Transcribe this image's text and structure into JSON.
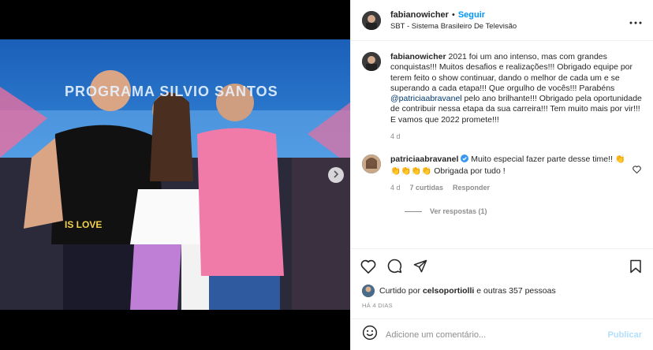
{
  "post": {
    "username": "fabianowicher",
    "follow_label": "Seguir",
    "location": "SBT - Sistema Brasileiro De Televisão",
    "caption_user": "fabianowicher",
    "caption_pre": " 2021 foi um ano intenso, mas com grandes conquistas!!! Muitos desafios e realizações!!! Obrigado equipe por terem feito o show continuar, dando o melhor de cada um e se superando a cada etapa!!! Que orgulho de vocês!!! Parabéns ",
    "caption_mention": "@patriciaabravanel",
    "caption_post": " pelo ano brilhante!!!  Obrigado pela oportunidade de contribuir nessa  etapa da sua carreira!!! Tem muito mais por vir!!!",
    "caption_line2": "E vamos que 2022 promete!!!",
    "caption_age": "4 d",
    "photo_banner": "PROGRAMA SILVIO SANTOS",
    "shirt_text": "IS LOVE"
  },
  "comment": {
    "user": "patriciaabravanel",
    "text": " Muito especial fazer parte desse time!! 👏 👏👏👏👏 Obrigada por tudo !",
    "age": "4 d",
    "likes": "7 curtidas",
    "reply": "Responder",
    "view_replies": "Ver respostas (1)"
  },
  "likes": {
    "prefix": "Curtido por ",
    "user": "celsoportiolli",
    "suffix": " e outras 357 pessoas"
  },
  "timestamp": "HÁ 4 DIAS",
  "add_comment": {
    "placeholder": "Adicione um comentário...",
    "publish": "Publicar"
  },
  "colors": {
    "link": "#0095f6",
    "mention": "#00376b",
    "muted": "#8e8e8e",
    "verified": "#3897f0"
  },
  "icons": [
    "more-icon",
    "heart-icon",
    "comment-icon",
    "share-icon",
    "bookmark-icon",
    "emoji-icon",
    "chevron-right-icon",
    "verified-icon"
  ]
}
